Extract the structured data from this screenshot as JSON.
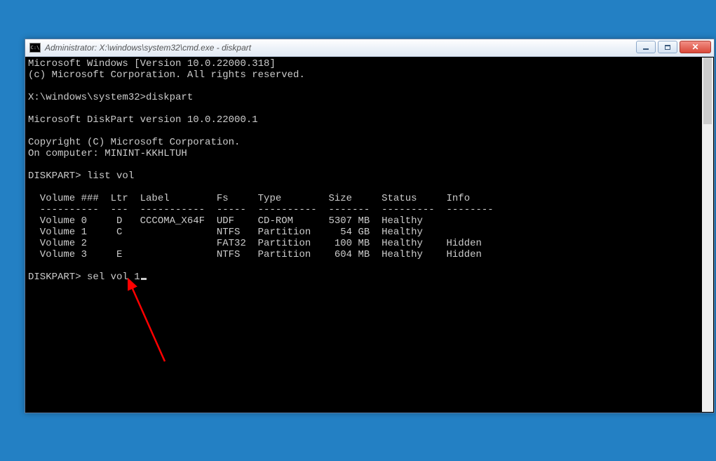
{
  "window": {
    "title": "Administrator: X:\\windows\\system32\\cmd.exe - diskpart",
    "icon_label": "C:\\"
  },
  "terminal": {
    "lines": [
      "Microsoft Windows [Version 10.0.22000.318]",
      "(c) Microsoft Corporation. All rights reserved.",
      "",
      "X:\\windows\\system32>diskpart",
      "",
      "Microsoft DiskPart version 10.0.22000.1",
      "",
      "Copyright (C) Microsoft Corporation.",
      "On computer: MININT-KKHLTUH",
      "",
      "DISKPART> list vol",
      "",
      "  Volume ###  Ltr  Label        Fs     Type        Size     Status     Info",
      "  ----------  ---  -----------  -----  ----------  -------  ---------  --------",
      "  Volume 0     D   CCCOMA_X64F  UDF    CD-ROM      5307 MB  Healthy",
      "  Volume 1     C                NTFS   Partition     54 GB  Healthy",
      "  Volume 2                      FAT32  Partition    100 MB  Healthy    Hidden",
      "  Volume 3     E                NTFS   Partition    604 MB  Healthy    Hidden",
      ""
    ],
    "prompt": "DISKPART> ",
    "current_input": "sel vol 1"
  },
  "volumes": [
    {
      "num": "Volume 0",
      "ltr": "D",
      "label": "CCCOMA_X64F",
      "fs": "UDF",
      "type": "CD-ROM",
      "size": "5307 MB",
      "status": "Healthy",
      "info": ""
    },
    {
      "num": "Volume 1",
      "ltr": "C",
      "label": "",
      "fs": "NTFS",
      "type": "Partition",
      "size": "54 GB",
      "status": "Healthy",
      "info": ""
    },
    {
      "num": "Volume 2",
      "ltr": "",
      "label": "",
      "fs": "FAT32",
      "type": "Partition",
      "size": "100 MB",
      "status": "Healthy",
      "info": "Hidden"
    },
    {
      "num": "Volume 3",
      "ltr": "E",
      "label": "",
      "fs": "NTFS",
      "type": "Partition",
      "size": "604 MB",
      "status": "Healthy",
      "info": "Hidden"
    }
  ]
}
